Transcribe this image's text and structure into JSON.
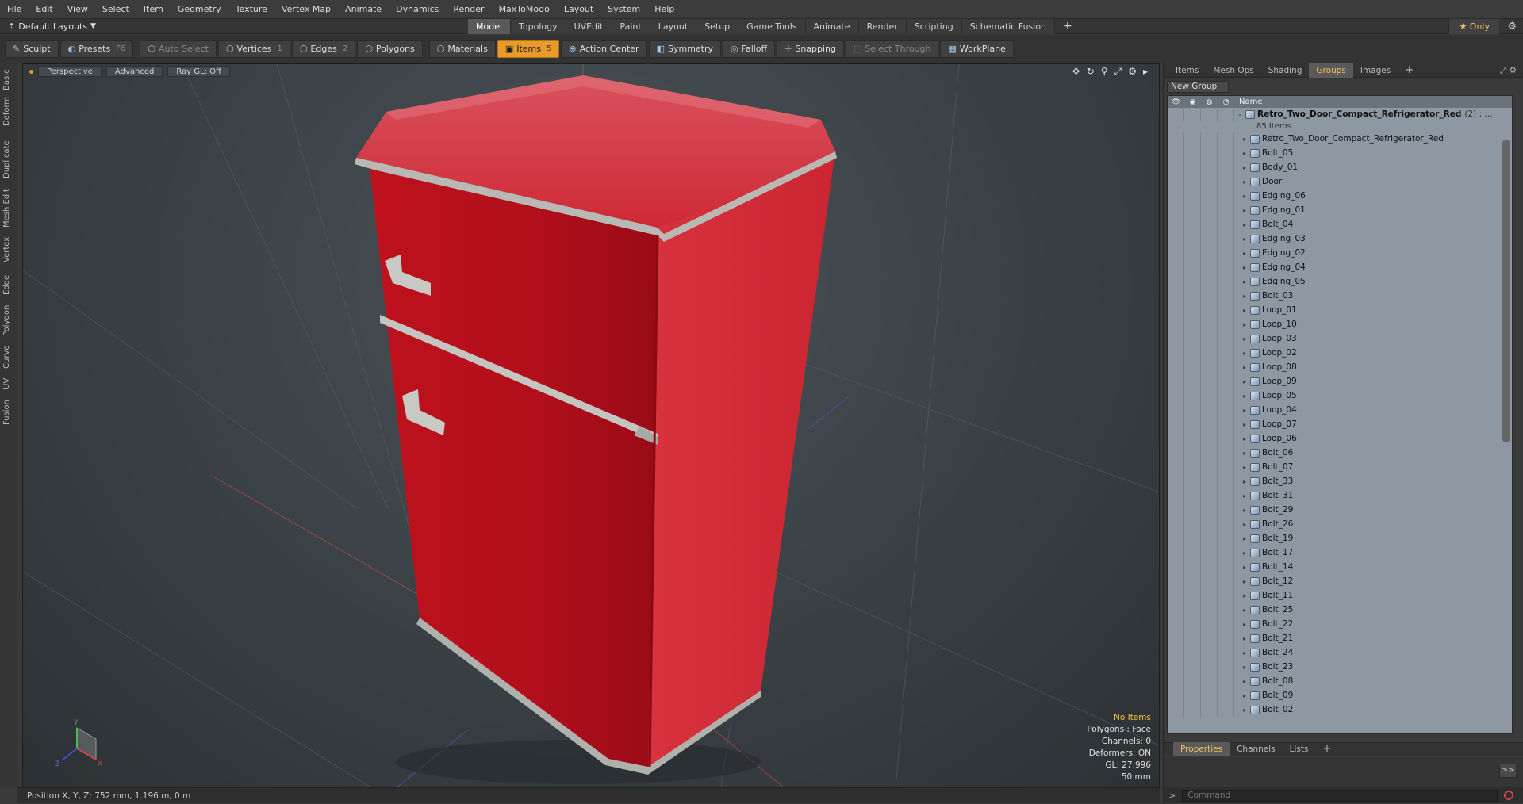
{
  "menu": [
    "File",
    "Edit",
    "View",
    "Select",
    "Item",
    "Geometry",
    "Texture",
    "Vertex Map",
    "Animate",
    "Dynamics",
    "Render",
    "MaxToModo",
    "Layout",
    "System",
    "Help"
  ],
  "layout_selector": "Default Layouts",
  "modes": [
    "Model",
    "Topology",
    "UVEdit",
    "Paint",
    "Layout",
    "Setup",
    "Game Tools",
    "Animate",
    "Render",
    "Scripting",
    "Schematic Fusion"
  ],
  "active_mode": "Model",
  "mode_plus": "+",
  "only_label": "★ Only",
  "toolbar": {
    "sculpt": "Sculpt",
    "presets": "Presets",
    "presets_key": "F6",
    "auto_select": "Auto Select",
    "vertices": "Vertices",
    "vertices_key": "1",
    "edges": "Edges",
    "edges_key": "2",
    "polygons": "Polygons",
    "materials": "Materials",
    "items": "Items",
    "items_key": "5",
    "action_center": "Action Center",
    "symmetry": "Symmetry",
    "falloff": "Falloff",
    "snapping": "Snapping",
    "select_through": "Select Through",
    "workplane": "WorkPlane"
  },
  "left_tabs": [
    "Basic",
    "Deform",
    "Duplicate",
    "Mesh Edit",
    "Vertex",
    "Edge",
    "Polygon",
    "Curve",
    "UV",
    "Fusion"
  ],
  "viewport": {
    "perspective": "Perspective",
    "advanced": "Advanced",
    "raygl": "Ray GL: Off",
    "axis_y": "Y",
    "axis_x": "X",
    "axis_z": "Z"
  },
  "stats": {
    "no_items": "No Items",
    "polygons": "Polygons : Face",
    "channels": "Channels: 0",
    "deformers": "Deformers: ON",
    "gl": "GL: 27,996",
    "scale": "50 mm"
  },
  "statusbar": "Position X, Y, Z:  752 mm, 1.196 m, 0 m",
  "right_tabs": [
    "Items",
    "Mesh Ops",
    "Shading",
    "Groups",
    "Images"
  ],
  "active_right_tab": "Groups",
  "right_tabs_plus": "+",
  "new_group": "New Group",
  "tree": {
    "name_header": "Name",
    "root_name": "Retro_Two_Door_Compact_Refrigerator_Red",
    "root_count": "(2) : ...",
    "root_sub": "85 Items",
    "items": [
      "Retro_Two_Door_Compact_Refrigerator_Red",
      "Bolt_05",
      "Body_01",
      "Door",
      "Edging_06",
      "Edging_01",
      "Bolt_04",
      "Edging_03",
      "Edging_02",
      "Edging_04",
      "Edging_05",
      "Bolt_03",
      "Loop_01",
      "Loop_10",
      "Loop_03",
      "Loop_02",
      "Loop_08",
      "Loop_09",
      "Loop_05",
      "Loop_04",
      "Loop_07",
      "Loop_06",
      "Bolt_06",
      "Bolt_07",
      "Bolt_33",
      "Bolt_31",
      "Bolt_29",
      "Bolt_26",
      "Bolt_19",
      "Bolt_17",
      "Bolt_14",
      "Bolt_12",
      "Bolt_11",
      "Bolt_25",
      "Bolt_22",
      "Bolt_21",
      "Bolt_24",
      "Bolt_23",
      "Bolt_08",
      "Bolt_09",
      "Bolt_02"
    ]
  },
  "bottom_tabs": [
    "Properties",
    "Channels",
    "Lists"
  ],
  "active_bottom_tab": "Properties",
  "bottom_tabs_plus": "+",
  "run_button": ">>",
  "command_prompt": ">",
  "command_placeholder": "Command",
  "colors": {
    "accent": "#e89a2a",
    "fridge_red": "#c8182a",
    "chrome": "#b8b8b4",
    "tree_bg": "#8e98a2"
  }
}
